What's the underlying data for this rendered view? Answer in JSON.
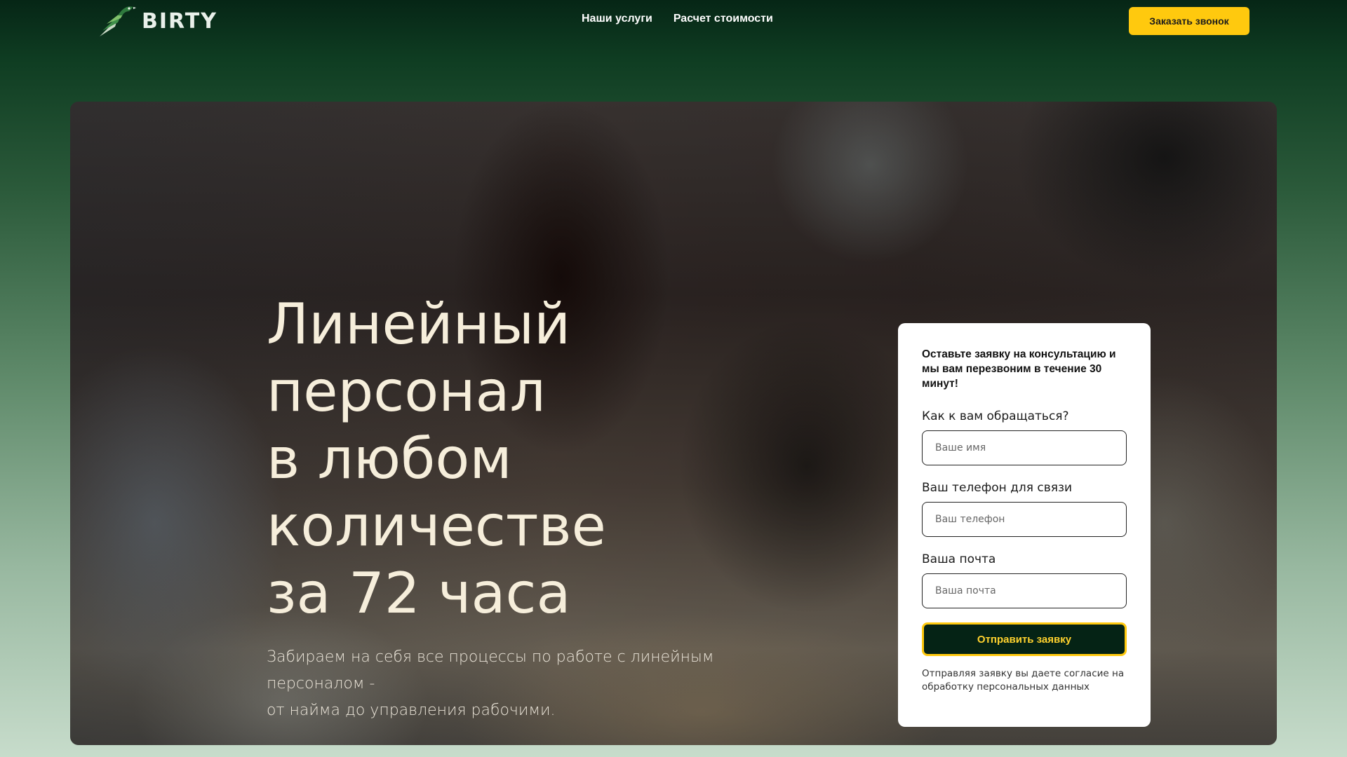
{
  "header": {
    "logo_text": "BIRTY",
    "nav": [
      {
        "label": "Наши услуги"
      },
      {
        "label": "Расчет стоимости"
      }
    ],
    "callback_button": "Заказать звонок"
  },
  "hero": {
    "title_lines": [
      "Линейный персонал",
      "в любом количестве",
      "за 72 часа"
    ],
    "subtitle_lines": [
      "Забираем на себя все процессы по работе с линейным персоналом -",
      "от найма до управления рабочими."
    ]
  },
  "form": {
    "heading": "Оставьте заявку на консультацию и мы вам перезвоним в течение 30 минут!",
    "fields": [
      {
        "label": "Как к вам обращаться?",
        "placeholder": "Ваше имя"
      },
      {
        "label": "Ваш телефон для связи",
        "placeholder": "Ваш телефон"
      },
      {
        "label": "Ваша почта",
        "placeholder": "Ваша почта"
      }
    ],
    "submit_label": "Отправить заявку",
    "consent_lines": [
      "Отправляя заявку вы даете согласие на",
      "обработку персональных данных"
    ]
  },
  "colors": {
    "accent_yellow": "#ffc90e",
    "dark_green": "#052315",
    "hero_text": "#f6eedb"
  },
  "icons": {
    "logo": "bird-logo-icon"
  }
}
